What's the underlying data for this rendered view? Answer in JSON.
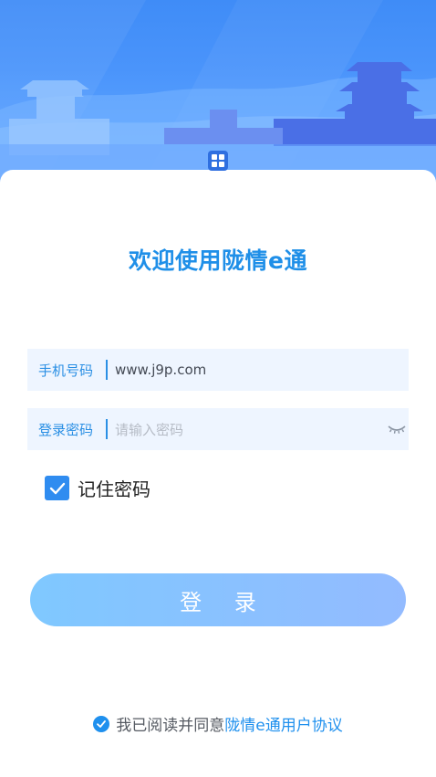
{
  "banner": {
    "app_icon": "grid-app-icon"
  },
  "welcome_title": "欢迎使用陇情e通",
  "phone_field": {
    "label": "手机号码",
    "value": "www.j9p.com"
  },
  "password_field": {
    "label": "登录密码",
    "placeholder": "请输入密码",
    "toggle_icon": "eye-closed-icon"
  },
  "remember": {
    "label": "记住密码",
    "checked": true
  },
  "login_button": "登 录",
  "agreement": {
    "text": "我已阅读并同意",
    "link": "陇情e通用户协议",
    "checked": true
  },
  "colors": {
    "primary": "#1f8fe8",
    "field_bg": "#eef5ff",
    "button_start": "#7fc8ff",
    "button_end": "#93bbff"
  }
}
